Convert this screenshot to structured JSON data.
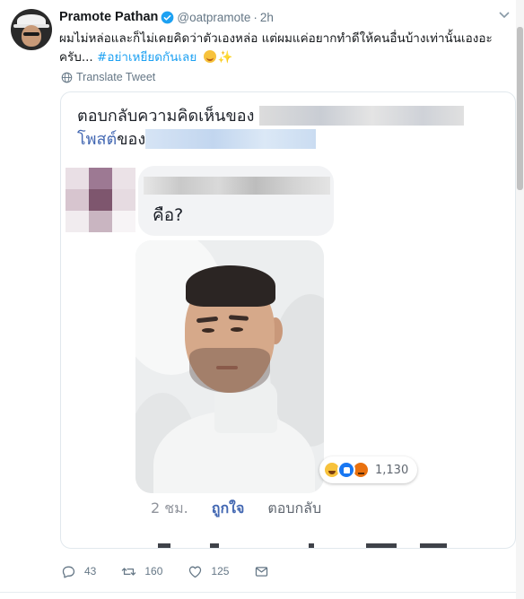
{
  "tweet": {
    "display_name": "Pramote Pathan",
    "handle": "@oatpramote",
    "separator": "·",
    "time": "2h",
    "text_line1": "ผมไม่หล่อและก็ไม่เคยคิดว่าตัวเองหล่อ แต่ผมแค่อยากทำดีให้คนอื่นบ้างเท่านั้นเองอะ",
    "text_line2": "ครับ... ",
    "hashtag": "#อย่าเหยียดกันเลย",
    "sparkle": "✨",
    "translate_label": "Translate Tweet",
    "icons": {
      "verified": "verified-badge-icon",
      "caret": "chevron-down-icon",
      "globe": "globe-icon"
    }
  },
  "screenshot": {
    "heading_prefix": "ตอบกลับความคิดเห็นของ",
    "post_link": "โพสต์",
    "post_of": "ของ",
    "comment_text": "คือ?",
    "reaction_count": "1,130",
    "reactions": [
      "haha",
      "like",
      "angry"
    ],
    "comment_time": "2 ชม.",
    "like_label": "ถูกใจ",
    "reply_label": "ตอบกลับ"
  },
  "actions": {
    "replies": "43",
    "retweets": "160",
    "likes": "125"
  },
  "colors": {
    "accent": "#1da1f2",
    "verified": "#1da1f2",
    "facebook_blue": "#4267b2",
    "text": "#14171a",
    "muted": "#657786"
  }
}
